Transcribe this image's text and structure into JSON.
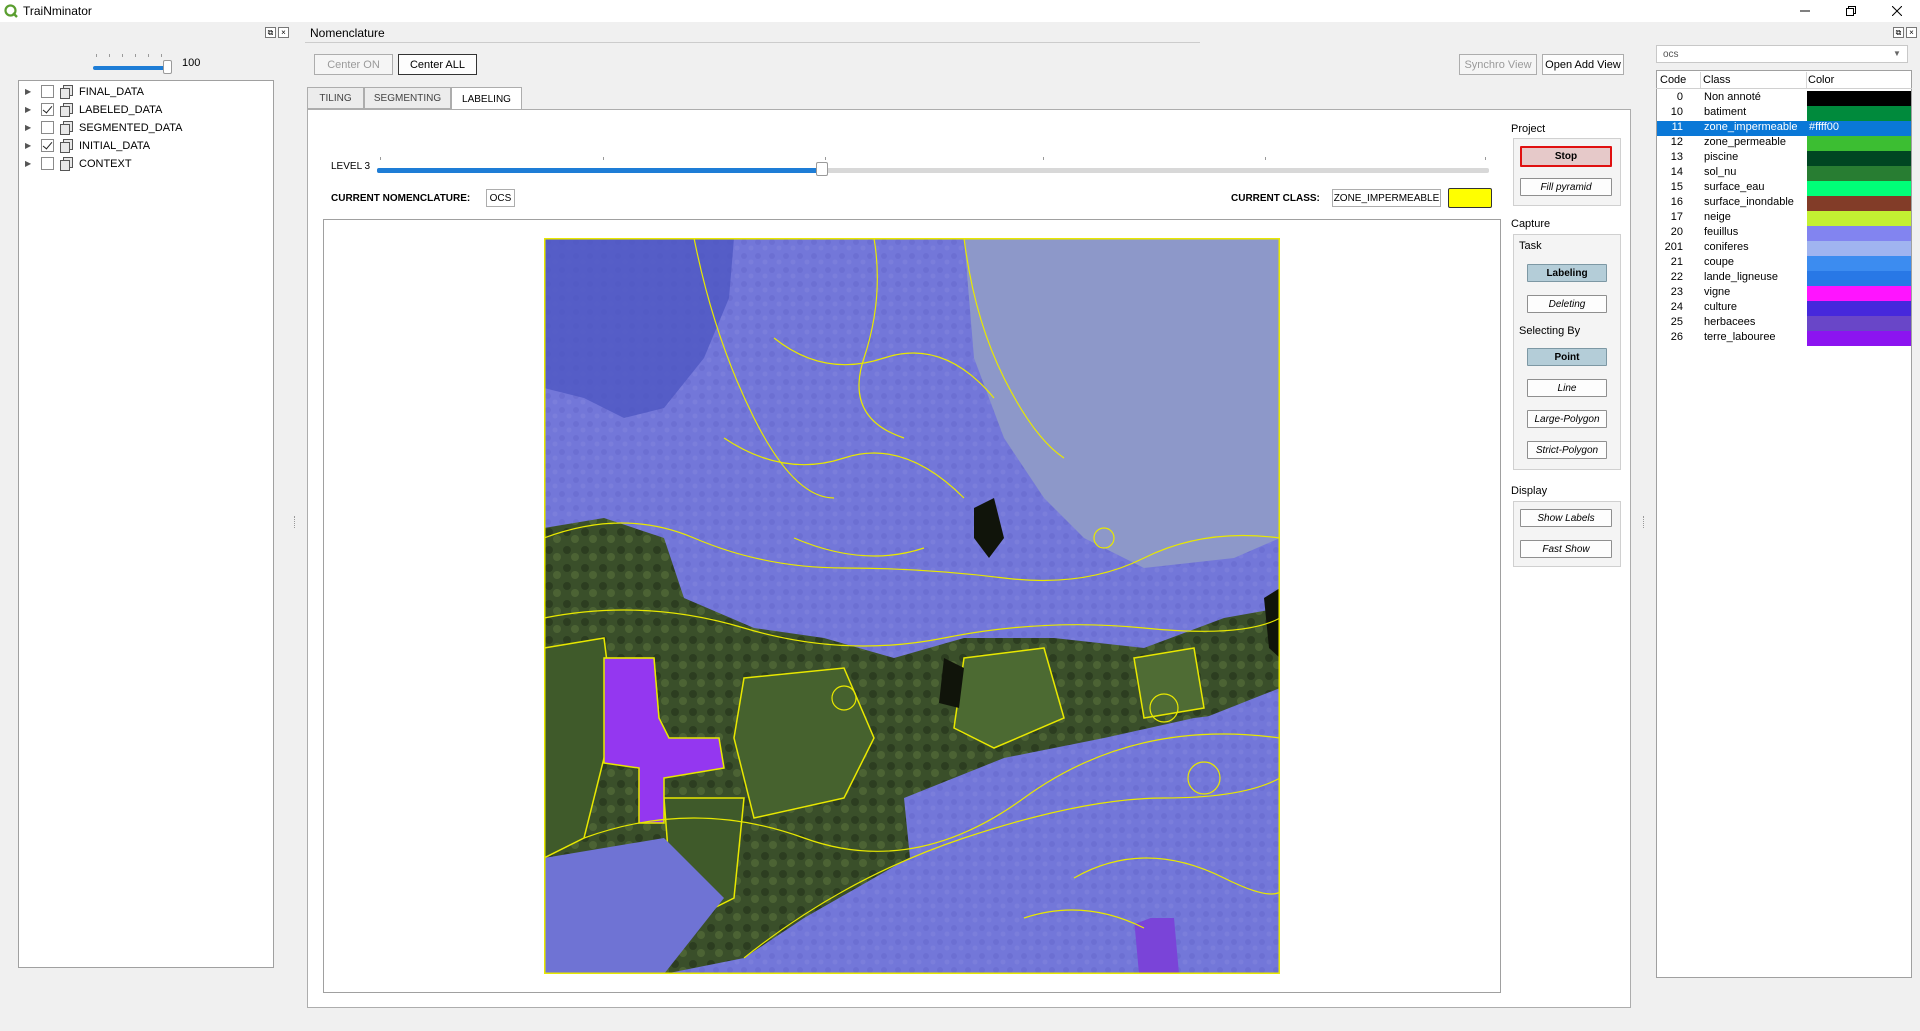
{
  "app": {
    "title": "TraiNminator"
  },
  "left_panel": {
    "opacity_value": "100",
    "layers": [
      {
        "name": "FINAL_DATA",
        "checked": false
      },
      {
        "name": "LABELED_DATA",
        "checked": true
      },
      {
        "name": "SEGMENTED_DATA",
        "checked": false
      },
      {
        "name": "INITIAL_DATA",
        "checked": true
      },
      {
        "name": "CONTEXT",
        "checked": false
      }
    ]
  },
  "center": {
    "dock_title": "Nomenclature",
    "buttons": {
      "center_on": "Center ON",
      "center_all": "Center ALL",
      "synchro_view": "Synchro View",
      "open_add_view": "Open Add View"
    },
    "tabs": [
      {
        "label": "TILING",
        "active": false
      },
      {
        "label": "SEGMENTING",
        "active": false
      },
      {
        "label": "LABELING",
        "active": true
      }
    ],
    "level": {
      "label": "LEVEL 3",
      "fraction": 0.4
    },
    "current_nomenclature_label": "CURRENT NOMENCLATURE:",
    "current_nomenclature_value": "OCS",
    "current_class_label": "CURRENT CLASS:",
    "current_class_value": "ZONE_IMPERMEABLE",
    "current_class_color": "#ffff00"
  },
  "tools": {
    "project_label": "Project",
    "stop": "Stop",
    "fill_pyramid": "Fill pyramid",
    "capture_label": "Capture",
    "task_label": "Task",
    "labeling": "Labeling",
    "deleting": "Deleting",
    "selecting_by_label": "Selecting By",
    "point": "Point",
    "line": "Line",
    "large_polygon": "Large-Polygon",
    "strict_polygon": "Strict-Polygon",
    "display_label": "Display",
    "show_labels": "Show Labels",
    "fast_show": "Fast Show"
  },
  "nomenclature_panel": {
    "selected_nomenclature": "ocs",
    "headers": {
      "code": "Code",
      "class": "Class",
      "color": "Color"
    },
    "selected_hex": "#ffff00",
    "rows": [
      {
        "code": "0",
        "class": "Non annoté",
        "color": "#000000"
      },
      {
        "code": "10",
        "class": "batiment",
        "color": "#008a3c"
      },
      {
        "code": "11",
        "class": "zone_impermeable",
        "color": "#ffff00"
      },
      {
        "code": "12",
        "class": "zone_permeable",
        "color": "#3cbe32"
      },
      {
        "code": "13",
        "class": "piscine",
        "color": "#004622"
      },
      {
        "code": "14",
        "class": "sol_nu",
        "color": "#287d32"
      },
      {
        "code": "15",
        "class": "surface_eau",
        "color": "#00ff78"
      },
      {
        "code": "16",
        "class": "surface_inondable",
        "color": "#823c28"
      },
      {
        "code": "17",
        "class": "neige",
        "color": "#c3f032"
      },
      {
        "code": "20",
        "class": "feuillus",
        "color": "#8284f0"
      },
      {
        "code": "201",
        "class": "coniferes",
        "color": "#a0b4f0"
      },
      {
        "code": "21",
        "class": "coupe",
        "color": "#3c8cf0"
      },
      {
        "code": "22",
        "class": "lande_ligneuse",
        "color": "#2878e6"
      },
      {
        "code": "23",
        "class": "vigne",
        "color": "#ff14ff"
      },
      {
        "code": "24",
        "class": "culture",
        "color": "#4628dc"
      },
      {
        "code": "25",
        "class": "herbacees",
        "color": "#6946c8"
      },
      {
        "code": "26",
        "class": "terre_labouree",
        "color": "#8c14f0"
      }
    ]
  }
}
